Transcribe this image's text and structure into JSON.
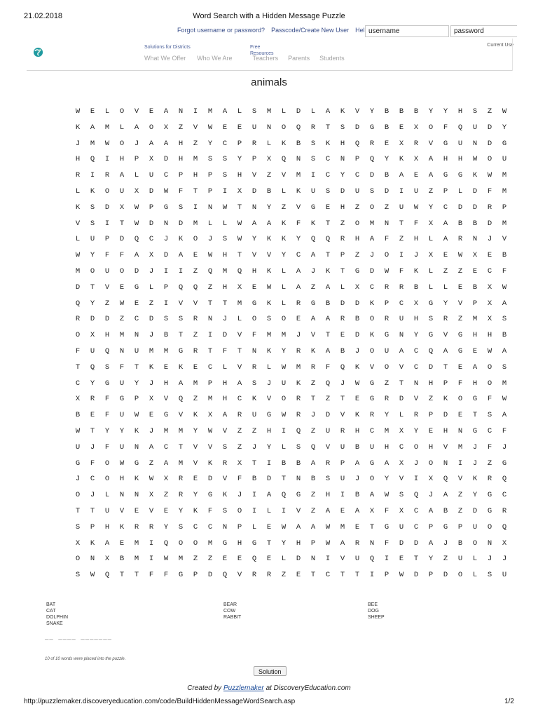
{
  "print_header": {
    "date": "21.02.2018",
    "title": "Word Search with a Hidden Message Puzzle"
  },
  "top_links": {
    "forgot": "Forgot username or password?",
    "passcode": "Passcode/Create New User",
    "help": "Help"
  },
  "login": {
    "username_value": "username",
    "password_value": "password"
  },
  "current_user": "Current Use",
  "nav_small": {
    "solutions": "Solutions for Districts",
    "free": "Free",
    "resources": "Resources"
  },
  "nav": [
    "What We Offer",
    "Who We Are",
    "Teachers",
    "Parents",
    "Students"
  ],
  "puzzle": {
    "title": "animals",
    "grid": [
      "WELOVEANIMALSMLDLAKVYBBBYYHSZW",
      "KAMLAOXZVWEEUNOQRTSDGBEXOFQUDY",
      "JMWOJAAHZYCPRLKBSKHQREXRVGUNDG",
      "HQIHPXDHMSSYPXQNSCNPQYKXAHHWOU",
      "RIRALUCPHPSHVZVMICYCDBAEAGGKWM",
      "LKOUXDWFTPIXDBLKUSDUSDIUZPLDFM",
      "KSDXWPGSINWTNYZVGEHZOZUWYCDDRP",
      "VSITWDNDMLLWAAKFKTZOMNTFXABBDM",
      "LUPDQCJKOJSWYKKYQQRHAFZHLARNJV",
      "WYFFAXDAEWHTVVYCATPZJOIJXEWXEB",
      "MOUODJIIZQMQHKLAJKTGDWFKLZZECF",
      "DTVEGLPQQZHXEWLAZALXCRRBLLEBXW",
      "QYZWEZIVVTTMGKLRGBDDKPCXGYVPXA",
      "RDDZCDSSRNJLOSOEAARBORUHSRZMXS",
      "OXHMNJBTZIDVFMMJVTEDKGNYGVGHHB",
      "FUQNUMMGRTFTNKYRKABJOUACQAGEWA",
      "TQSFTKEKECLVRLWMRFQKVOVCDTEAOS",
      "CYGUYJHAMPHASJUKZQJWGZTNHPFHOM",
      "XRFGPXVQZMHCKVORTZTEGRDVZKOGFW",
      "BEFUWEGVKXARUGWRJDVKRYLRPDETSA",
      "WTYYKJMMYWVZZHIQZURHCMXYEHNGCF",
      "UJFUNACTVVSZJYLSQVUBUHCOHVMJFJ",
      "GFOWGZAMVKRXTIBBARPAGAXJONIJZG",
      "JCOHKWXREDVFBDTNBSUJOYVIXQVKRQ",
      "OJLNNXZRYGKJIAQGZHIBAWSQJAZYGC",
      "TTUVEVEYKFSOILIVZAEAXFXCABZDGR",
      "SPHKRRYSCCNPLEWAAWMETGUCPGPUOQ",
      "XKAEMIQOOMGHGTYHPWARNFDDAJBONX",
      "ONXBMIWMZZEEQELDNIVUQIETYZULJJ",
      "SWQTTFFGPDQVRRZETCTTIPWDPDOLSU"
    ],
    "word_columns": [
      [
        "BAT",
        "CAT",
        "DOLPHIN",
        "SNAKE"
      ],
      [
        "BEAR",
        "COW",
        "RABBIT"
      ],
      [
        "BEE",
        "DOG",
        "SHEEP"
      ]
    ],
    "hidden_message_blanks": "__  ____  _______",
    "placed_note": "10 of 10 words were placed into the puzzle.",
    "solution_label": "Solution"
  },
  "credit": {
    "created_by": "Created by",
    "puzzlemaker": "Puzzlemaker",
    "at": "at DiscoveryEducation.com"
  },
  "print_footer": {
    "url": "http://puzzlemaker.discoveryeducation.com/code/BuildHiddenMessageWordSearch.asp",
    "page": "1/2"
  },
  "colors": {
    "link": "#3a4f8a",
    "nav_gray": "#a3a3a3",
    "logo_teal": "#1f9aa0",
    "credit_link": "#1f4e9a"
  }
}
